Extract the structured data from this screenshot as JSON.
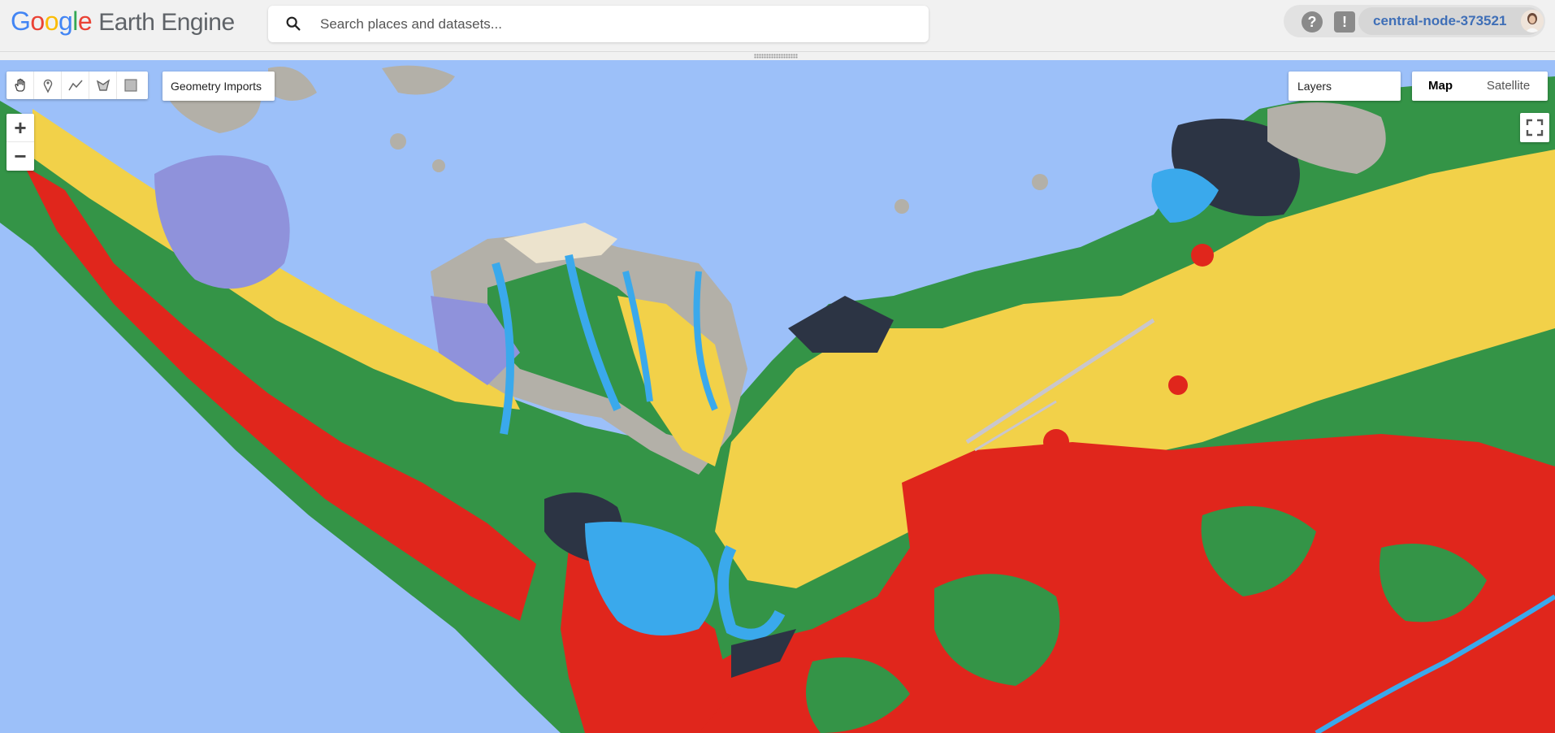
{
  "app": {
    "logo_google": [
      "G",
      "o",
      "o",
      "g",
      "l",
      "e"
    ],
    "logo_product": "Earth Engine"
  },
  "search": {
    "placeholder": "Search places and datasets...",
    "icon": "search-icon"
  },
  "account": {
    "help_icon": "help-icon",
    "help_glyph": "?",
    "feedback_icon": "feedback-icon",
    "feedback_glyph": "!",
    "project": "central-node-373521",
    "avatar_icon": "user-avatar"
  },
  "map_controls": {
    "tools": [
      "hand-pan-icon",
      "marker-icon",
      "polyline-icon",
      "polygon-icon",
      "rectangle-icon"
    ],
    "geometry_imports": "Geometry Imports",
    "zoom_in": "+",
    "zoom_out": "−",
    "layers": "Layers",
    "map_type": {
      "map": "Map",
      "satellite": "Satellite",
      "selected": "Map"
    },
    "fullscreen_icon": "fullscreen-icon"
  },
  "colors": {
    "water": "#9cc0f9",
    "river": "#3aa9ec",
    "green": "#349447",
    "yellow": "#f2d149",
    "red": "#e0261c",
    "grey": "#b3b0a8",
    "sand": "#ece3cd",
    "purple": "#8f92db",
    "dark": "#2c3444"
  }
}
